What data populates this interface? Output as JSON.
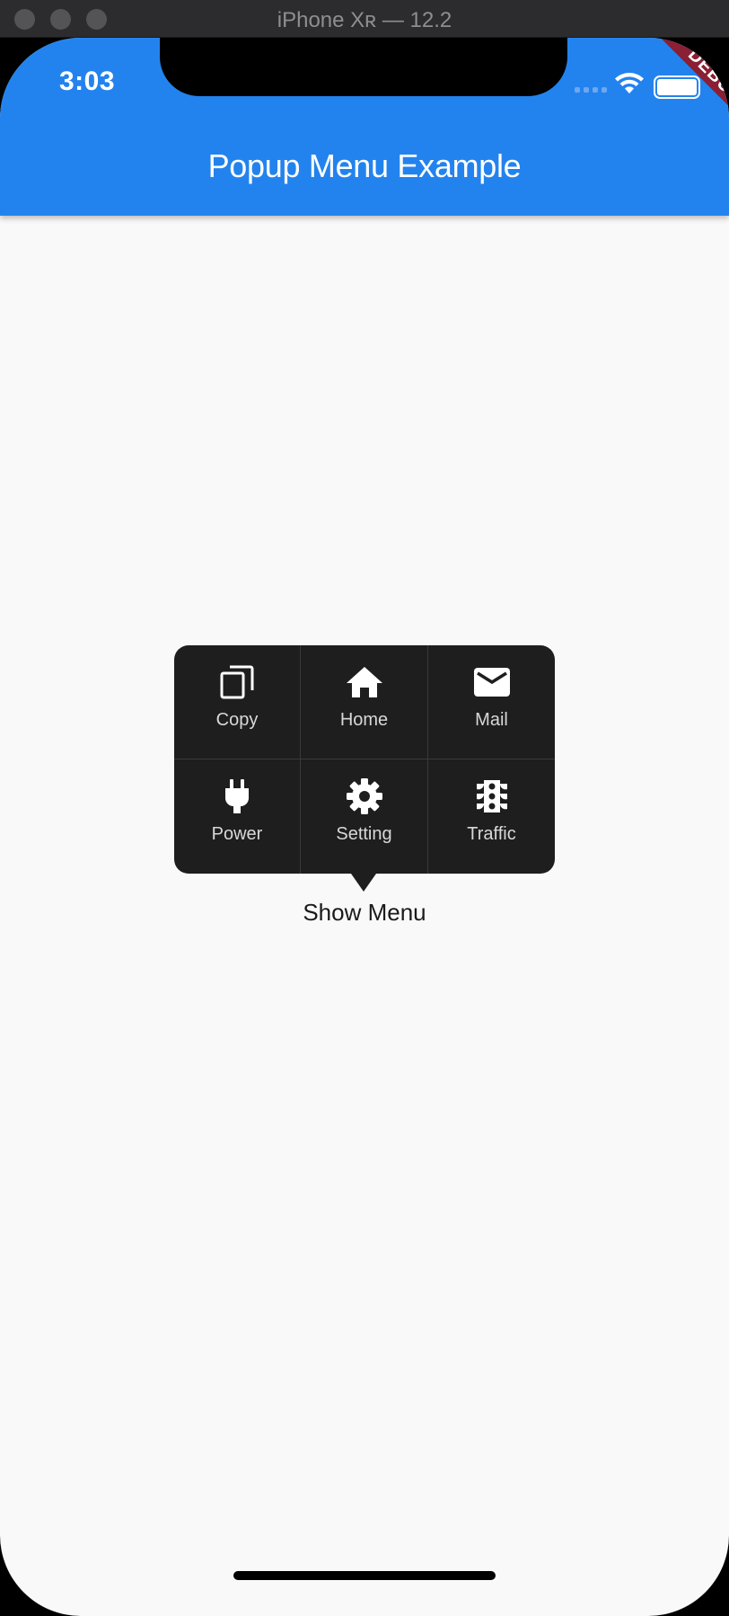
{
  "window": {
    "title": "iPhone Xʀ — 12.2"
  },
  "status_bar": {
    "time": "3:03"
  },
  "debug_banner": "DEBUG",
  "app_bar": {
    "title": "Popup Menu Example"
  },
  "menu": {
    "items": [
      {
        "label": "Copy",
        "icon": "copy-icon"
      },
      {
        "label": "Home",
        "icon": "home-icon"
      },
      {
        "label": "Mail",
        "icon": "mail-icon"
      },
      {
        "label": "Power",
        "icon": "power-plug-icon"
      },
      {
        "label": "Setting",
        "icon": "gear-icon"
      },
      {
        "label": "Traffic",
        "icon": "traffic-light-icon"
      }
    ]
  },
  "button": {
    "label": "Show Menu"
  },
  "colors": {
    "app_bar": "#2383ee",
    "menu_bg": "#1e1e1e",
    "debug": "#8b1f33",
    "page_bg": "#f9f9f9"
  }
}
